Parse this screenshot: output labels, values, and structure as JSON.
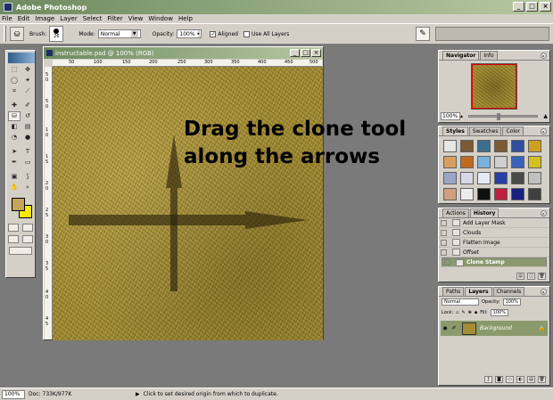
{
  "app": {
    "title": "Adobe Photoshop"
  },
  "window_controls": {
    "minimize": "_",
    "maximize": "□",
    "close": "×"
  },
  "menu": [
    "File",
    "Edit",
    "Image",
    "Layer",
    "Select",
    "Filter",
    "View",
    "Window",
    "Help"
  ],
  "options": {
    "brush_label": "Brush:",
    "brush_size": "26",
    "mode_label": "Mode:",
    "mode_value": "Normal",
    "opacity_label": "Opacity:",
    "opacity_value": "100%",
    "aligned_label": "Aligned",
    "aligned_checked": "✓",
    "use_all_layers_label": "Use All Layers"
  },
  "document": {
    "title": "instructable.psd @ 100% (RGB)",
    "ruler_h": [
      "50",
      "100",
      "150",
      "200",
      "250",
      "300",
      "350",
      "400",
      "450",
      "500"
    ],
    "ruler_v": [
      "5",
      "0",
      "5",
      "0",
      "1",
      "0",
      "1",
      "5",
      "2",
      "0",
      "2",
      "5",
      "3",
      "0",
      "3",
      "5",
      "4",
      "0",
      "4",
      "5"
    ]
  },
  "annotation": {
    "line1": "Drag the clone tool",
    "line2": "along the arrows"
  },
  "colors": {
    "foreground": "#c4a55a",
    "background": "#ffe800",
    "selected_row": "#8a9a6c",
    "titlebar": "#6e8a5e"
  },
  "navigator": {
    "tabs": [
      "Navigator",
      "Info"
    ],
    "zoom": "100%"
  },
  "styles": {
    "tabs": [
      "Styles",
      "Swatches",
      "Color"
    ],
    "swatches": [
      "#e6e6e6",
      "#7a5a32",
      "#3c6e8c",
      "#7c5a36",
      "#2e4ea0",
      "#cfa020",
      "#d8a060",
      "#c06a1e",
      "#7ab0de",
      "#cfcfcf",
      "#3a60b8",
      "#d4c020",
      "#9aa6c8",
      "#d8d8e8",
      "#e6eaf4",
      "#2a3ea8",
      "#4a4a4a",
      "#c0c0c0",
      "#d0a080",
      "#ececec",
      "#101010",
      "#c02040",
      "#1a2080",
      "#404040"
    ]
  },
  "history": {
    "tabs": [
      "Actions",
      "History"
    ],
    "items": [
      "Add Layer Mask",
      "Clouds",
      "Flatten Image",
      "Offset",
      "Clone Stamp"
    ]
  },
  "layers": {
    "tabs": [
      "Paths",
      "Layers",
      "Channels"
    ],
    "blend": "Normal",
    "opacity_label": "Opacity:",
    "opacity_value": "100%",
    "lock_label": "Lock:",
    "fill_label": "Fill:",
    "fill_value": "100%",
    "layer_name": "Background"
  },
  "status": {
    "zoom": "100%",
    "doc": "Doc: 733K/977K",
    "hint": "Click to set desired origin from which to duplicate."
  }
}
